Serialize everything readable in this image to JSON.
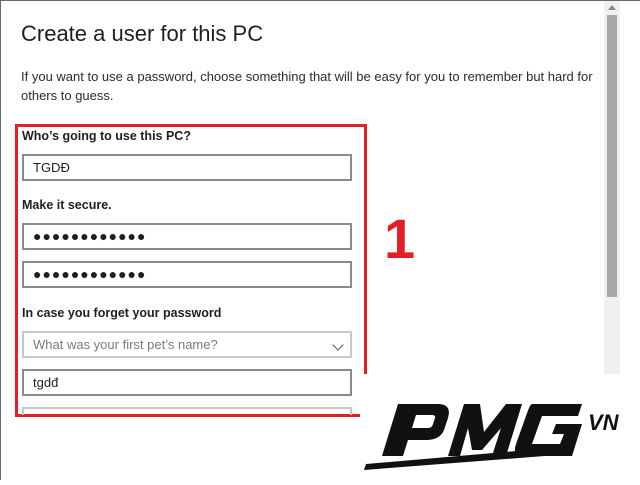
{
  "dialog": {
    "title": "Create a user for this PC",
    "description": "If you want to use a password, choose something that will be easy for you to remember but hard for others to guess."
  },
  "form": {
    "who_label": "Who’s going to use this PC?",
    "username_value": "TGDĐ",
    "secure_label": "Make it secure.",
    "password_value": "●●●●●●●●●●●●",
    "password_confirm_value": "●●●●●●●●●●●●",
    "forget_label": "In case you forget your password",
    "question_select_value": "What was your first pet’s name?",
    "answer_value": "tgdđ"
  },
  "annotation": {
    "step_number": "1",
    "highlight_color": "#e21f26"
  },
  "watermark": {
    "logo_text": "PMG",
    "logo_suffix": "VN"
  }
}
